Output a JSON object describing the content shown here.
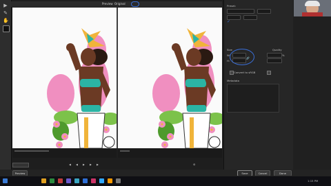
{
  "canvas_tabs": [
    {
      "label": "Preview"
    },
    {
      "label": "Original"
    }
  ],
  "tools": [
    {
      "icon": "selection-arrow-icon"
    },
    {
      "icon": "pencil-icon"
    },
    {
      "icon": "hand-icon"
    },
    {
      "icon": "color-swatch-icon"
    }
  ],
  "panel": {
    "preset_label": "Preset:",
    "size_label": "Size",
    "width_label": "W:",
    "height_label": "H:",
    "percent_label": "%",
    "quality_label": "Quality",
    "convert_label": "Convert to sRGB",
    "metadata_label": "Metadata"
  },
  "colors": {
    "annotation": "#3a6fd8",
    "preview_bg": "#fafafa",
    "skin": "#6b3a24",
    "outfit": "#2bb4a4",
    "feathers": "#f08fc0",
    "leaves": "#7cc24a"
  },
  "footer_buttons": [
    {
      "label": "Preview"
    },
    {
      "label": "Save"
    },
    {
      "label": "Cancel"
    },
    {
      "label": "Done"
    }
  ],
  "taskbar": {
    "clock": "1:15 PM"
  }
}
